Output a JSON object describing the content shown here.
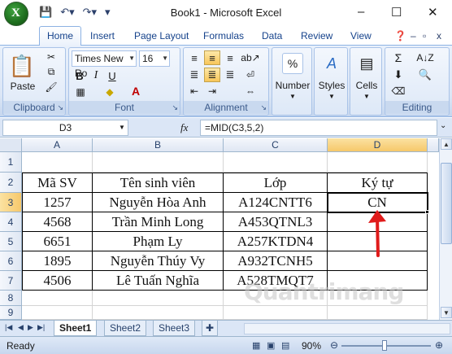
{
  "title": "Book1 - Microsoft Excel",
  "window_controls": [
    "–",
    "☐",
    "✕"
  ],
  "tabs": [
    {
      "label": "Home",
      "active": true
    },
    {
      "label": "Insert"
    },
    {
      "label": "Page Layout"
    },
    {
      "label": "Formulas"
    },
    {
      "label": "Data"
    },
    {
      "label": "Review"
    },
    {
      "label": "View"
    }
  ],
  "ribbon": {
    "clipboard": {
      "label": "Clipboard",
      "paste": "Paste"
    },
    "font": {
      "label": "Font",
      "font_name": "Times New Ro",
      "font_size": "16",
      "bold": "B",
      "italic": "I",
      "underline": "U",
      "font_color_glyph": "A"
    },
    "alignment": {
      "label": "Alignment"
    },
    "number": {
      "label": "Number",
      "percent": "%"
    },
    "styles": {
      "label": "Styles"
    },
    "cells": {
      "label": "Cells"
    },
    "editing": {
      "label": "Editing",
      "sum": "Σ"
    }
  },
  "formula_bar": {
    "name_box": "D3",
    "fx": "fx",
    "formula": "=MID(C3,5,2)"
  },
  "grid": {
    "columns": [
      "A",
      "B",
      "C",
      "D"
    ],
    "active_column": "D",
    "rows": [
      "1",
      "2",
      "3",
      "4",
      "5",
      "6",
      "7",
      "8",
      "9"
    ],
    "active_row": "3",
    "header_row": [
      "Mã SV",
      "Tên sinh viên",
      "Lớp",
      "Ký tự"
    ],
    "data": [
      [
        "1257",
        "Nguyễn Hòa Anh",
        "A124CNTT6",
        "CN"
      ],
      [
        "4568",
        "Trần Minh Long",
        "A453QTNL3",
        ""
      ],
      [
        "6651",
        "Phạm Ly",
        "A257KTDN4",
        ""
      ],
      [
        "1895",
        "Nguyễn Thúy Vy",
        "A932TCNH5",
        ""
      ],
      [
        "4506",
        "Lê Tuấn Nghĩa",
        "A528TMQT7",
        ""
      ]
    ]
  },
  "sheets": [
    {
      "label": "Sheet1",
      "active": true
    },
    {
      "label": "Sheet2"
    },
    {
      "label": "Sheet3"
    }
  ],
  "status": {
    "ready": "Ready",
    "zoom": "90%"
  },
  "watermark": "Quantrimang",
  "colors": {
    "arrow": "#e01b1b",
    "ribbon_bg": "#dbe6f6",
    "active_header": "#f6c86a",
    "excel_green": "#1e6e1e"
  }
}
